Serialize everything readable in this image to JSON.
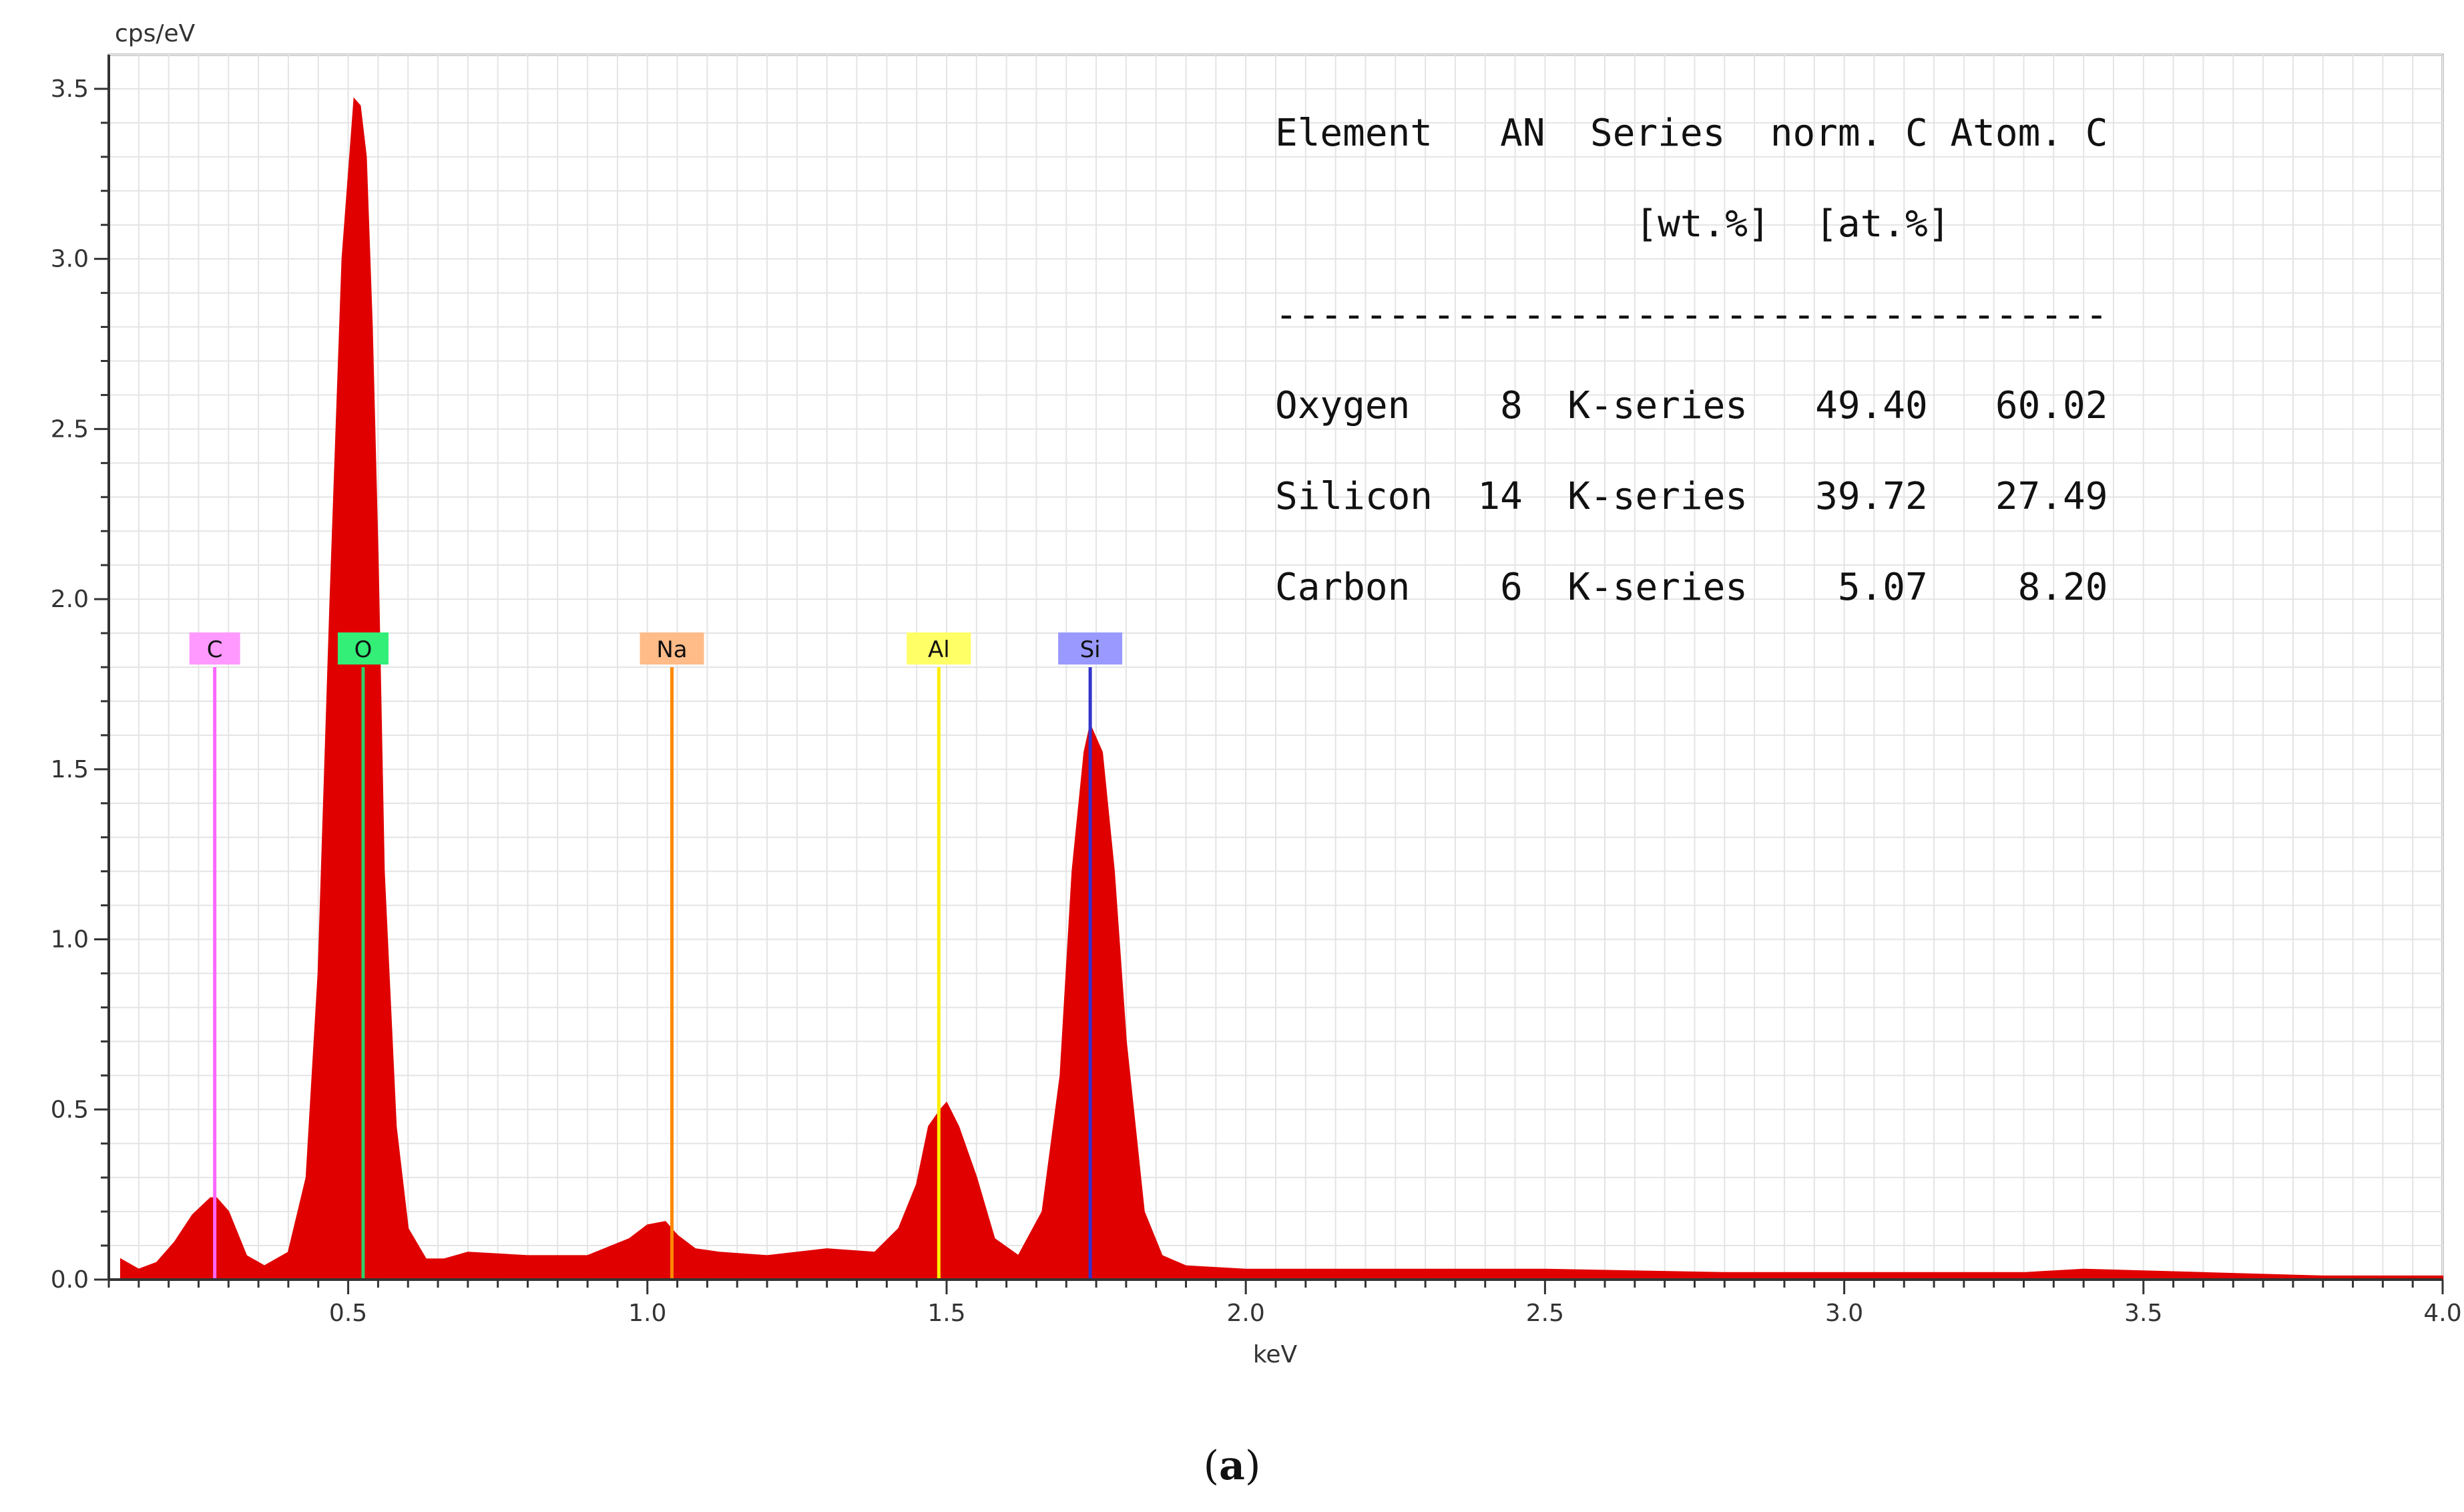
{
  "caption": {
    "open": "(",
    "letter": "a",
    "close": ")"
  },
  "chart_data": {
    "type": "area",
    "xlabel": "keV",
    "ylabel": "cps/eV",
    "xlim": [
      0.1,
      4.0
    ],
    "ylim": [
      0,
      3.6
    ],
    "xticks": [
      "0.5",
      "1.0",
      "1.5",
      "2.0",
      "2.5",
      "3.0",
      "3.5",
      "4.0"
    ],
    "xtick_values": [
      0.5,
      1.0,
      1.5,
      2.0,
      2.5,
      3.0,
      3.5,
      4.0
    ],
    "yticks": [
      "0.0",
      "0.5",
      "1.0",
      "1.5",
      "2.0",
      "2.5",
      "3.0",
      "3.5"
    ],
    "ytick_values": [
      0,
      0.5,
      1.0,
      1.5,
      2.0,
      2.5,
      3.0,
      3.5
    ],
    "grid": true,
    "series": [
      {
        "color": "#e00000",
        "x": [
          0.12,
          0.15,
          0.18,
          0.21,
          0.24,
          0.27,
          0.28,
          0.3,
          0.33,
          0.36,
          0.4,
          0.43,
          0.45,
          0.47,
          0.49,
          0.51,
          0.52,
          0.53,
          0.54,
          0.55,
          0.56,
          0.58,
          0.6,
          0.63,
          0.66,
          0.7,
          0.8,
          0.9,
          0.97,
          1.0,
          1.03,
          1.05,
          1.08,
          1.12,
          1.2,
          1.3,
          1.38,
          1.42,
          1.45,
          1.47,
          1.49,
          1.5,
          1.52,
          1.55,
          1.58,
          1.62,
          1.66,
          1.69,
          1.71,
          1.73,
          1.74,
          1.76,
          1.78,
          1.8,
          1.83,
          1.86,
          1.9,
          2.0,
          2.2,
          2.5,
          2.8,
          3.0,
          3.3,
          3.4,
          3.6,
          3.8,
          4.0
        ],
        "y": [
          0.06,
          0.03,
          0.05,
          0.11,
          0.19,
          0.24,
          0.24,
          0.2,
          0.07,
          0.04,
          0.08,
          0.3,
          0.9,
          2.0,
          3.0,
          3.47,
          3.45,
          3.3,
          2.8,
          2.1,
          1.2,
          0.45,
          0.15,
          0.06,
          0.06,
          0.08,
          0.07,
          0.07,
          0.12,
          0.16,
          0.17,
          0.13,
          0.09,
          0.08,
          0.07,
          0.09,
          0.08,
          0.15,
          0.28,
          0.45,
          0.5,
          0.52,
          0.45,
          0.3,
          0.12,
          0.07,
          0.2,
          0.6,
          1.2,
          1.55,
          1.63,
          1.55,
          1.2,
          0.7,
          0.2,
          0.07,
          0.04,
          0.03,
          0.03,
          0.03,
          0.02,
          0.02,
          0.02,
          0.03,
          0.02,
          0.01,
          0.01
        ]
      }
    ],
    "element_markers": [
      {
        "symbol": "C",
        "energy": 0.277,
        "color": "#ff66ff",
        "label_bg": "#ff99ff"
      },
      {
        "symbol": "O",
        "energy": 0.525,
        "color": "#33cc66",
        "label_bg": "#33ee77"
      },
      {
        "symbol": "Na",
        "energy": 1.041,
        "color": "#ff8800",
        "label_bg": "#ffbb88"
      },
      {
        "symbol": "Al",
        "energy": 1.487,
        "color": "#ffee00",
        "label_bg": "#ffff66"
      },
      {
        "symbol": "Si",
        "energy": 1.74,
        "color": "#3333cc",
        "label_bg": "#9999ff"
      }
    ],
    "marker_height": 1.8,
    "table": {
      "header1": "Element   AN  Series  norm. C Atom. C",
      "header2": "                [wt.%]  [at.%]",
      "separator": "-------------------------------------",
      "rows": [
        "Oxygen    8  K-series   49.40   60.02",
        "Silicon  14  K-series   39.72   27.49",
        "Carbon    6  K-series    5.07    8.20"
      ]
    }
  }
}
